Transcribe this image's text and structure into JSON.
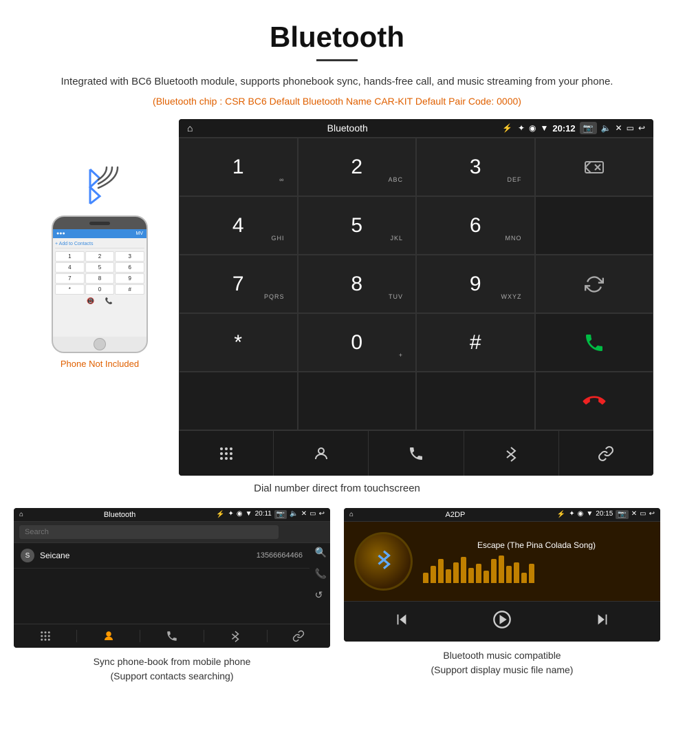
{
  "page": {
    "title": "Bluetooth",
    "subtitle": "Integrated with BC6 Bluetooth module, supports phonebook sync, hands-free call, and music streaming from your phone.",
    "tech_info": "(Bluetooth chip : CSR BC6    Default Bluetooth Name CAR-KIT    Default Pair Code: 0000)",
    "phone_not_included": "Phone Not Included",
    "dial_caption": "Dial number direct from touchscreen",
    "phonebook_caption": "Sync phone-book from mobile phone\n(Support contacts searching)",
    "music_caption": "Bluetooth music compatible\n(Support display music file name)"
  },
  "status_bar": {
    "title": "Bluetooth",
    "time": "20:12"
  },
  "dial_keys": [
    {
      "num": "1",
      "sub": "∞"
    },
    {
      "num": "2",
      "sub": "ABC"
    },
    {
      "num": "3",
      "sub": "DEF"
    },
    {
      "num": "",
      "sub": "",
      "special": "backspace"
    },
    {
      "num": "4",
      "sub": "GHI"
    },
    {
      "num": "5",
      "sub": "JKL"
    },
    {
      "num": "6",
      "sub": "MNO"
    },
    {
      "num": "",
      "sub": "",
      "special": "empty"
    },
    {
      "num": "7",
      "sub": "PQRS"
    },
    {
      "num": "8",
      "sub": "TUV"
    },
    {
      "num": "9",
      "sub": "WXYZ"
    },
    {
      "num": "",
      "sub": "",
      "special": "refresh"
    },
    {
      "num": "*",
      "sub": ""
    },
    {
      "num": "0",
      "sub": "+"
    },
    {
      "num": "#",
      "sub": ""
    },
    {
      "num": "",
      "sub": "",
      "special": "call-green"
    },
    {
      "num": "",
      "sub": "",
      "special": "call-red"
    }
  ],
  "toolbar_buttons": [
    "grid",
    "person",
    "phone",
    "bluetooth",
    "link"
  ],
  "phonebook": {
    "title": "Bluetooth",
    "time": "20:11",
    "search_placeholder": "Search",
    "contacts": [
      {
        "letter": "S",
        "name": "Seicane",
        "number": "13566664466"
      }
    ],
    "caption": "Sync phone-book from mobile phone\n(Support contacts searching)"
  },
  "music": {
    "title": "A2DP",
    "time": "20:15",
    "song_title": "Escape (The Pina Colada Song)",
    "eq_heights": [
      15,
      25,
      35,
      20,
      30,
      38,
      22,
      28,
      18,
      35,
      40,
      25,
      30,
      15,
      28
    ],
    "caption": "Bluetooth music compatible\n(Support display music file name)"
  }
}
